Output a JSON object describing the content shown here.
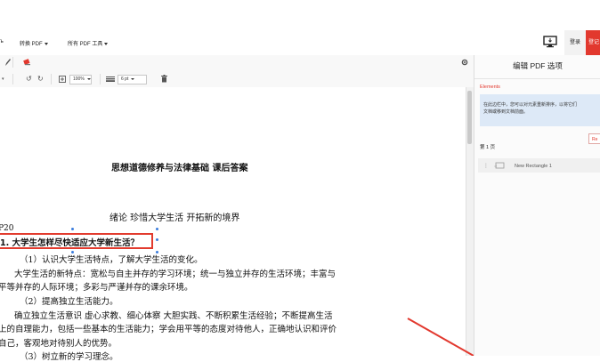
{
  "nav": {
    "convert_pdf": "转换 PDF",
    "all_tools": "所有 PDF 工具",
    "login": "登录",
    "signup": "登记"
  },
  "toolbar": {
    "zoom": "100%",
    "stroke": "6 pt"
  },
  "document": {
    "title": "思想道德修养与法律基础  课后答案",
    "subtitle": "绪论    珍惜大学生活    开拓新的境界",
    "page_ref": "P20",
    "question": "1. 大学生怎样尽快适应大学新生活？",
    "lines": [
      "（1）认识大学生活特点，了解大学生活的变化。",
      "大学生活的新特点：宽松与自主并存的学习环境；统一与独立并存的生活环境；丰富与",
      "平等并存的人际环境；多彩与严谨并存的课余环境。",
      "（2）提高独立生活能力。",
      "确立独立生活意识  虚心求教、细心体察  大胆实践、不断积累生活经验；不断提高生活",
      "上的自理能力，包括一些基本的生活能力；学会用平等的态度对待他人，正确地认识和评价",
      "自己，客观地对待别人的优势。",
      "（3）树立新的学习理念。"
    ]
  },
  "panel": {
    "title": "编辑 PDF 选项",
    "elements_label": "Elements",
    "info_line1": "在此边栏中，您可以对元素重新排序，以将它们",
    "info_line2": "文档或移到文档前面。",
    "reset": "Re",
    "page_label": "第 1 页",
    "element_name": "New Rectangle 1"
  },
  "icons": [
    "monitor-icon",
    "pen-icon",
    "eraser-icon",
    "gear-icon",
    "undo-icon",
    "redo-icon",
    "zoom-icon",
    "line-width-icon",
    "trash-icon",
    "drag-handle-icon",
    "rectangle-icon"
  ],
  "colors": {
    "accent": "#e2382e",
    "info_bg": "#dde9f7",
    "selection_handle": "#3b7ddd"
  }
}
